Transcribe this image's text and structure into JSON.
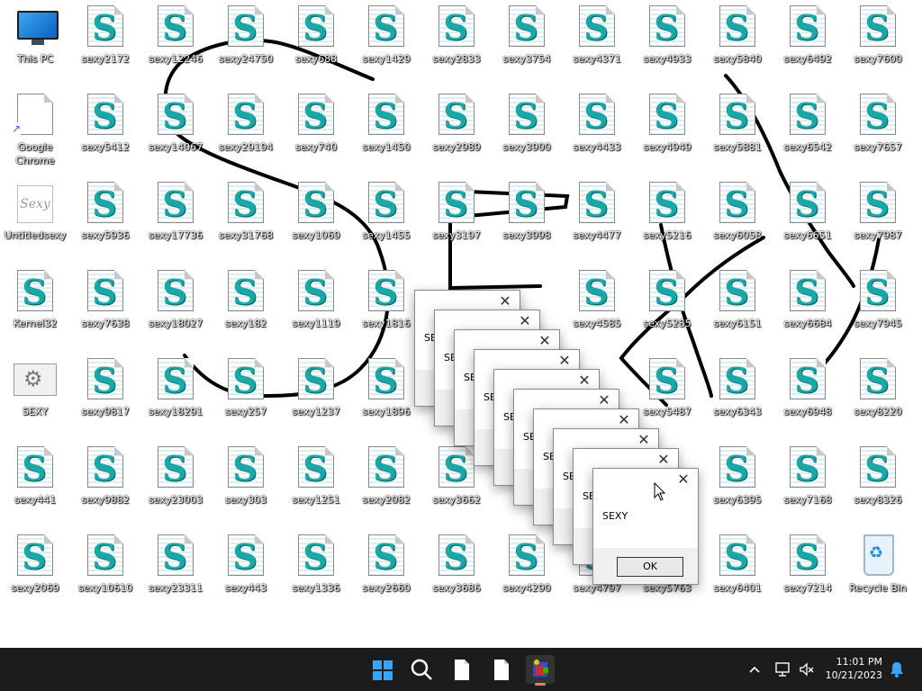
{
  "desktop": {
    "icons": [
      {
        "id": "this-pc",
        "label": "This PC",
        "kind": "computer"
      },
      {
        "id": "sexy2172",
        "label": "sexy2172",
        "kind": "sexy-file"
      },
      {
        "id": "sexy12246",
        "label": "sexy12246",
        "kind": "sexy-file"
      },
      {
        "id": "sexy24750",
        "label": "sexy24750",
        "kind": "sexy-file"
      },
      {
        "id": "sexy688",
        "label": "sexy688",
        "kind": "sexy-file"
      },
      {
        "id": "sexy1429",
        "label": "sexy1429",
        "kind": "sexy-file"
      },
      {
        "id": "sexy2833",
        "label": "sexy2833",
        "kind": "sexy-file"
      },
      {
        "id": "sexy3754",
        "label": "sexy3754",
        "kind": "sexy-file"
      },
      {
        "id": "sexy4371",
        "label": "sexy4371",
        "kind": "sexy-file"
      },
      {
        "id": "sexy4933",
        "label": "sexy4933",
        "kind": "sexy-file"
      },
      {
        "id": "sexy5840",
        "label": "sexy5840",
        "kind": "sexy-file"
      },
      {
        "id": "sexy6492",
        "label": "sexy6492",
        "kind": "sexy-file"
      },
      {
        "id": "sexy7600",
        "label": "sexy7600",
        "kind": "sexy-file"
      },
      {
        "id": "google-chrome",
        "label": "Google Chrome",
        "kind": "shortcut"
      },
      {
        "id": "sexy5412",
        "label": "sexy5412",
        "kind": "sexy-file"
      },
      {
        "id": "sexy14067",
        "label": "sexy14067",
        "kind": "sexy-file"
      },
      {
        "id": "sexy29194",
        "label": "sexy29194",
        "kind": "sexy-file"
      },
      {
        "id": "sexy740",
        "label": "sexy740",
        "kind": "sexy-file"
      },
      {
        "id": "sexy1450",
        "label": "sexy1450",
        "kind": "sexy-file"
      },
      {
        "id": "sexy2989",
        "label": "sexy2989",
        "kind": "sexy-file"
      },
      {
        "id": "sexy3900",
        "label": "sexy3900",
        "kind": "sexy-file"
      },
      {
        "id": "sexy4433",
        "label": "sexy4433",
        "kind": "sexy-file"
      },
      {
        "id": "sexy4949",
        "label": "sexy4949",
        "kind": "sexy-file"
      },
      {
        "id": "sexy5881",
        "label": "sexy5881",
        "kind": "sexy-file"
      },
      {
        "id": "sexy6542",
        "label": "sexy6542",
        "kind": "sexy-file"
      },
      {
        "id": "sexy7657",
        "label": "sexy7657",
        "kind": "sexy-file"
      },
      {
        "id": "untitledsexy",
        "label": "Untitledsexy",
        "kind": "paint",
        "image_text": "Sexy"
      },
      {
        "id": "sexy5936",
        "label": "sexy5936",
        "kind": "sexy-file"
      },
      {
        "id": "sexy17736",
        "label": "sexy17736",
        "kind": "sexy-file"
      },
      {
        "id": "sexy31768",
        "label": "sexy31768",
        "kind": "sexy-file"
      },
      {
        "id": "sexy1069",
        "label": "sexy1069",
        "kind": "sexy-file"
      },
      {
        "id": "sexy1455",
        "label": "sexy1455",
        "kind": "sexy-file"
      },
      {
        "id": "sexy3197",
        "label": "sexy3197",
        "kind": "sexy-file"
      },
      {
        "id": "sexy3998",
        "label": "sexy3998",
        "kind": "sexy-file"
      },
      {
        "id": "sexy4477",
        "label": "sexy4477",
        "kind": "sexy-file"
      },
      {
        "id": "sexy5216",
        "label": "sexy5216",
        "kind": "sexy-file"
      },
      {
        "id": "sexy6058",
        "label": "sexy6058",
        "kind": "sexy-file"
      },
      {
        "id": "sexy6651",
        "label": "sexy6651",
        "kind": "sexy-file"
      },
      {
        "id": "sexy7987",
        "label": "sexy7987",
        "kind": "sexy-file"
      },
      {
        "id": "kernel32",
        "label": "Kernel32",
        "kind": "sexy-file"
      },
      {
        "id": "sexy7638",
        "label": "sexy7638",
        "kind": "sexy-file"
      },
      {
        "id": "sexy18027",
        "label": "sexy18027",
        "kind": "sexy-file"
      },
      {
        "id": "sexy182",
        "label": "sexy182",
        "kind": "sexy-file"
      },
      {
        "id": "sexy1119",
        "label": "sexy1119",
        "kind": "sexy-file"
      },
      {
        "id": "sexy1816",
        "label": "sexy1816",
        "kind": "sexy-file"
      },
      {
        "id": "sexy4585",
        "label": "sexy4585",
        "kind": "sexy-file"
      },
      {
        "id": "sexy5285",
        "label": "sexy5285",
        "kind": "sexy-file"
      },
      {
        "id": "sexy6151",
        "label": "sexy6151",
        "kind": "sexy-file"
      },
      {
        "id": "sexy6684",
        "label": "sexy6684",
        "kind": "sexy-file"
      },
      {
        "id": "sexy7945",
        "label": "sexy7945",
        "kind": "sexy-file"
      },
      {
        "id": "sexy-app",
        "label": "SEXY",
        "kind": "settings-app"
      },
      {
        "id": "sexy9817",
        "label": "sexy9817",
        "kind": "sexy-file"
      },
      {
        "id": "sexy18291",
        "label": "sexy18291",
        "kind": "sexy-file"
      },
      {
        "id": "sexy257",
        "label": "sexy257",
        "kind": "sexy-file"
      },
      {
        "id": "sexy1237",
        "label": "sexy1237",
        "kind": "sexy-file"
      },
      {
        "id": "sexy1896",
        "label": "sexy1896",
        "kind": "sexy-file"
      },
      {
        "id": "sexy5487",
        "label": "sexy5487",
        "kind": "sexy-file"
      },
      {
        "id": "sexy6343",
        "label": "sexy6343",
        "kind": "sexy-file"
      },
      {
        "id": "sexy6948",
        "label": "sexy6948",
        "kind": "sexy-file"
      },
      {
        "id": "sexy8220",
        "label": "sexy8220",
        "kind": "sexy-file"
      },
      {
        "id": "sexy441",
        "label": "sexy441",
        "kind": "sexy-file"
      },
      {
        "id": "sexy9882",
        "label": "sexy9882",
        "kind": "sexy-file"
      },
      {
        "id": "sexy23003",
        "label": "sexy23003",
        "kind": "sexy-file"
      },
      {
        "id": "sexy303",
        "label": "sexy303",
        "kind": "sexy-file"
      },
      {
        "id": "sexy1251",
        "label": "sexy1251",
        "kind": "sexy-file"
      },
      {
        "id": "sexy2082",
        "label": "sexy2082",
        "kind": "sexy-file"
      },
      {
        "id": "sexy3662",
        "label": "sexy3662",
        "kind": "sexy-file"
      },
      {
        "id": "sexy6395",
        "label": "sexy6395",
        "kind": "sexy-file"
      },
      {
        "id": "sexy7168",
        "label": "sexy7168",
        "kind": "sexy-file"
      },
      {
        "id": "sexy8326",
        "label": "sexy8326",
        "kind": "sexy-file"
      },
      {
        "id": "sexy2069",
        "label": "sexy2069",
        "kind": "sexy-file"
      },
      {
        "id": "sexy10610",
        "label": "sexy10610",
        "kind": "sexy-file"
      },
      {
        "id": "sexy23311",
        "label": "sexy23311",
        "kind": "sexy-file"
      },
      {
        "id": "sexy443",
        "label": "sexy443",
        "kind": "sexy-file"
      },
      {
        "id": "sexy1336",
        "label": "sexy1336",
        "kind": "sexy-file"
      },
      {
        "id": "sexy2660",
        "label": "sexy2660",
        "kind": "sexy-file"
      },
      {
        "id": "sexy3686",
        "label": "sexy3686",
        "kind": "sexy-file"
      },
      {
        "id": "sexy4290",
        "label": "sexy4290",
        "kind": "sexy-file"
      },
      {
        "id": "sexy4797",
        "label": "sexy4797",
        "kind": "sexy-file"
      },
      {
        "id": "sexy5763",
        "label": "sexy5763",
        "kind": "sexy-file"
      },
      {
        "id": "sexy6401",
        "label": "sexy6401",
        "kind": "sexy-file"
      },
      {
        "id": "sexy7214",
        "label": "sexy7214",
        "kind": "sexy-file"
      },
      {
        "id": "recycle-bin",
        "label": "Recycle Bin",
        "kind": "recycle-bin"
      }
    ]
  },
  "dialogs": {
    "message": "SEXY",
    "ok_label": "OK",
    "close_glyph": "✕",
    "stacked_count": 10
  },
  "taskbar": {
    "start_icon": "windows-logo-icon",
    "search_icon": "search-icon",
    "pinned": [
      {
        "name": "file-icon"
      },
      {
        "name": "file-icon"
      },
      {
        "name": "malware-app-icon",
        "active": true
      }
    ],
    "tray": {
      "chevron_icon": "chevron-up-icon",
      "network_icon": "network-icon",
      "volume_icon": "volume-muted-icon",
      "notification_icon": "bell-icon",
      "time": "11:01 PM",
      "date": "10/21/2023"
    },
    "accent_color": "#3aa3f3"
  }
}
